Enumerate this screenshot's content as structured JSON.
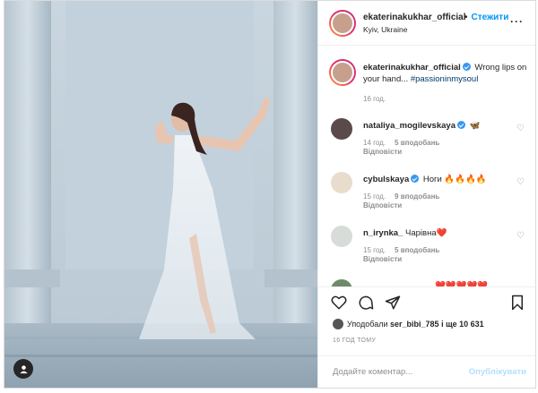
{
  "header": {
    "username": "ekaterinakukhar_official",
    "separator": "•",
    "follow_label": "Стежити",
    "location": "Kyiv, Ukraine",
    "more_label": "···"
  },
  "caption": {
    "username": "ekaterinakukhar_official",
    "text": "Wrong lips on your hand...",
    "hashtag": "#passioninmysoul",
    "time": "16 год."
  },
  "comments": [
    {
      "username": "nataliya_mogilevskaya",
      "verified": true,
      "text": "🦋",
      "time": "14 год.",
      "likes": "5 вподобань",
      "reply": "Відповісти"
    },
    {
      "username": "cybulskaya",
      "verified": true,
      "text": "Ноги 🔥🔥🔥🔥",
      "time": "15 год.",
      "likes": "9 вподобань",
      "reply": "Відповісти"
    },
    {
      "username": "n_irynka_",
      "verified": false,
      "text": "Чарівна❤️",
      "time": "15 год.",
      "likes": "5 вподобань",
      "reply": "Відповісти"
    },
    {
      "username": "",
      "verified": false,
      "text": "❤️❤️❤️❤️❤️",
      "time": "",
      "likes": "",
      "reply": ""
    }
  ],
  "actions": {
    "like_icon": "heart-icon",
    "comment_icon": "comment-icon",
    "share_icon": "send-icon",
    "save_icon": "bookmark-icon"
  },
  "likes": {
    "prefix": "Уподобали",
    "user": "ser_bibi_785",
    "suffix": "і ще 10 631"
  },
  "timestamp": "16 ГОД ТОМУ",
  "comment_input": {
    "placeholder": "Додайте коментар...",
    "post_label": "Опублікувати"
  },
  "colors": {
    "accent": "#0095f6",
    "verified": "#3897f0",
    "muted": "#8e8e8e",
    "post_disabled": "#b2dffc"
  }
}
